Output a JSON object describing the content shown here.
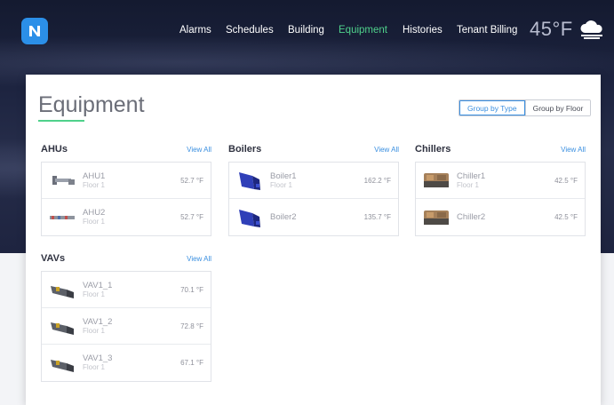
{
  "nav": {
    "items": [
      {
        "label": "Alarms",
        "active": false
      },
      {
        "label": "Schedules",
        "active": false
      },
      {
        "label": "Building",
        "active": false
      },
      {
        "label": "Equipment",
        "active": true
      },
      {
        "label": "Histories",
        "active": false
      },
      {
        "label": "Tenant Billing",
        "active": false
      }
    ]
  },
  "weather": {
    "temperature": "45°F",
    "icon": "cloud-icon"
  },
  "page": {
    "title": "Equipment"
  },
  "grouping": {
    "by_type": "Group by Type",
    "by_floor": "Group by Floor",
    "selected": "Group by Type"
  },
  "groups": {
    "ahus": {
      "title": "AHUs",
      "view_all": "View All",
      "items": [
        {
          "name": "AHU1",
          "floor": "Floor 1",
          "value": "52.7 °F"
        },
        {
          "name": "AHU2",
          "floor": "Floor 1",
          "value": "52.7 °F"
        }
      ]
    },
    "boilers": {
      "title": "Boilers",
      "view_all": "View All",
      "items": [
        {
          "name": "Boiler1",
          "floor": "Floor 1",
          "value": "162.2 °F"
        },
        {
          "name": "Boiler2",
          "floor": "",
          "value": "135.7 °F"
        }
      ]
    },
    "chillers": {
      "title": "Chillers",
      "view_all": "View All",
      "items": [
        {
          "name": "Chiller1",
          "floor": "Floor 1",
          "value": "42.5 °F"
        },
        {
          "name": "Chiller2",
          "floor": "",
          "value": "42.5 °F"
        }
      ]
    },
    "vavs": {
      "title": "VAVs",
      "view_all": "View All",
      "items": [
        {
          "name": "VAV1_1",
          "floor": "Floor 1",
          "value": "70.1 °F"
        },
        {
          "name": "VAV1_2",
          "floor": "Floor 1",
          "value": "72.8 °F"
        },
        {
          "name": "VAV1_3",
          "floor": "Floor 1",
          "value": "67.1 °F"
        }
      ]
    }
  },
  "colors": {
    "accent": "#4fd18b",
    "link": "#3a8fe0",
    "logo": "#2b8fe8"
  }
}
